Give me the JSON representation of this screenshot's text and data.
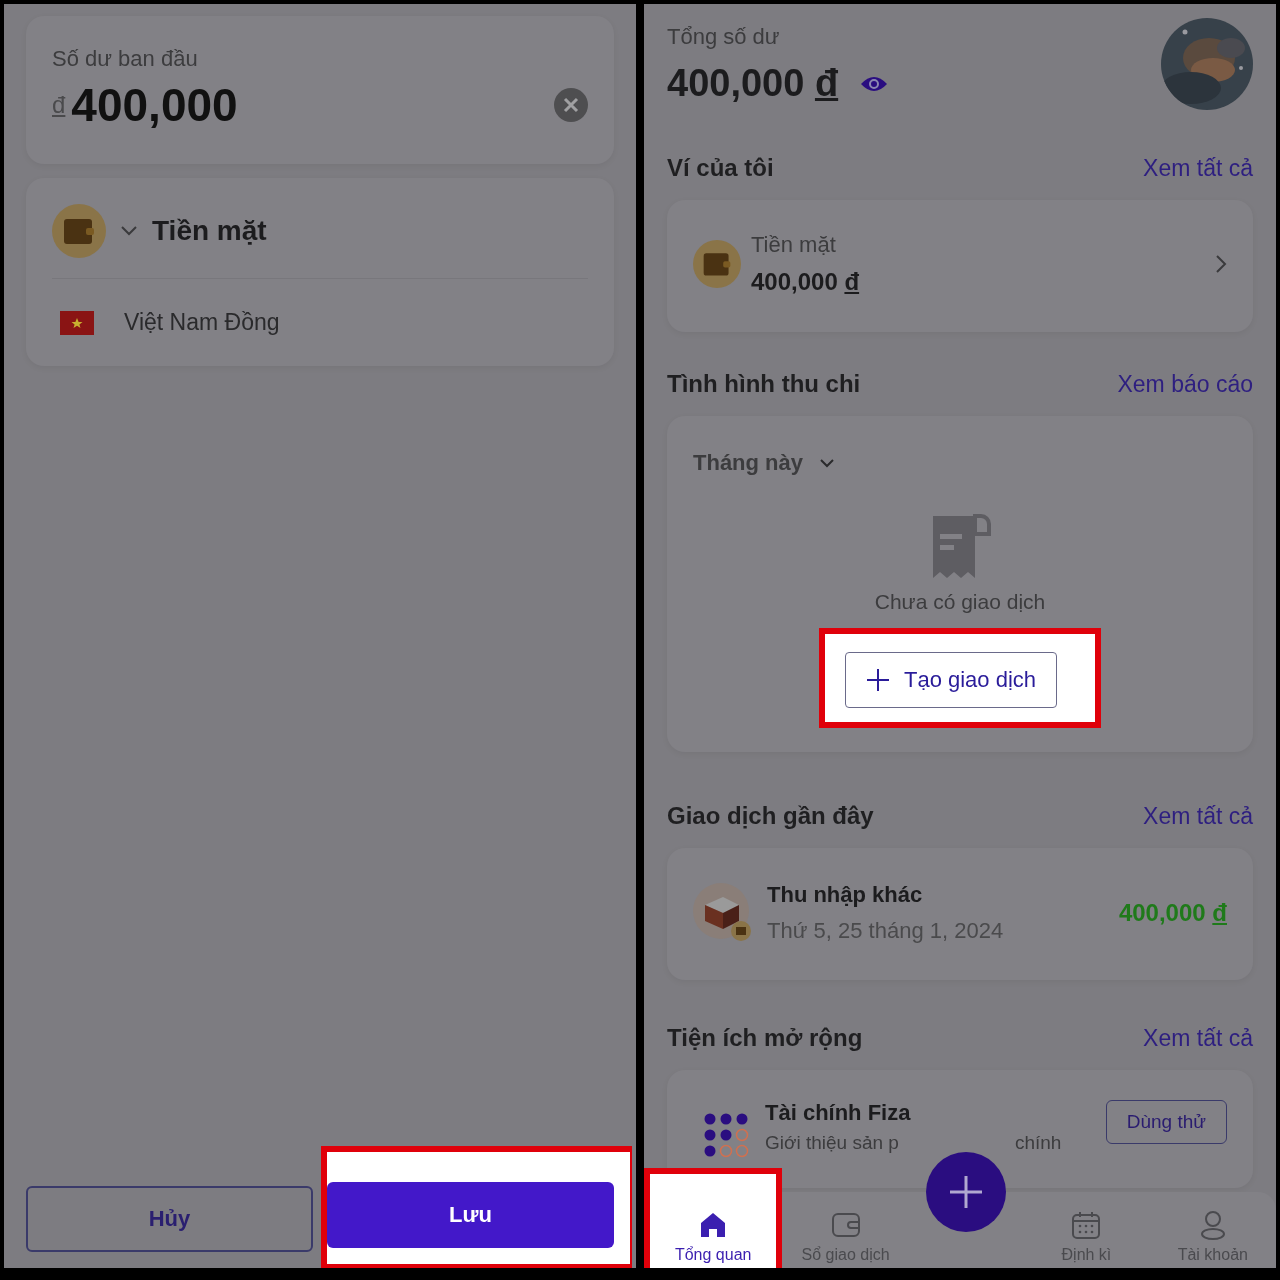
{
  "left": {
    "balance": {
      "label": "Số dư ban đầu",
      "currency": "đ",
      "value": "400,000"
    },
    "wallet": {
      "name": "Tiền mặt"
    },
    "currency_name": "Việt Nam Đồng",
    "buttons": [
      {
        "label": "Hủy",
        "kind": "secondary",
        "highlighted": false
      },
      {
        "label": "Lưu",
        "kind": "primary",
        "highlighted": true
      }
    ]
  },
  "right": {
    "total": {
      "label": "Tổng số dư",
      "amount": "400,000",
      "currency": "đ"
    },
    "my_wallets": {
      "title": "Ví của tôi",
      "link": "Xem tất cả",
      "wallet": {
        "name": "Tiền mặt",
        "amount": "400,000",
        "currency": "đ"
      }
    },
    "income_expense": {
      "title": "Tình hình thu chi",
      "link": "Xem báo cáo",
      "period": "Tháng này",
      "empty_text": "Chưa có giao dịch",
      "button": "Tạo giao dịch",
      "highlighted": true
    },
    "recent": {
      "title": "Giao dịch gần đây",
      "link": "Xem tất cả",
      "transactions": [
        {
          "name": "Thu nhập khác",
          "date": "Thứ 5, 25 tháng 1, 2024",
          "amount": "400,000",
          "currency": "đ"
        }
      ]
    },
    "extensions": {
      "title": "Tiện ích mở rộng",
      "link": "Xem tất cả",
      "items": [
        {
          "name": "Tài chính Fiza",
          "description_parts": [
            "Giới thiệu sản p",
            "chính"
          ],
          "button": "Dùng thử"
        }
      ]
    },
    "bottom_nav": [
      {
        "label": "Tổng quan",
        "kind": "home",
        "selected": true,
        "highlighted": true
      },
      {
        "label": "Sổ giao dịch",
        "kind": "wallet",
        "selected": false,
        "highlighted": false
      },
      {
        "kind": "add"
      },
      {
        "label": "Định kì",
        "kind": "calendar",
        "selected": false,
        "highlighted": false
      },
      {
        "label": "Tài khoản",
        "kind": "account",
        "selected": false,
        "highlighted": false
      }
    ]
  }
}
